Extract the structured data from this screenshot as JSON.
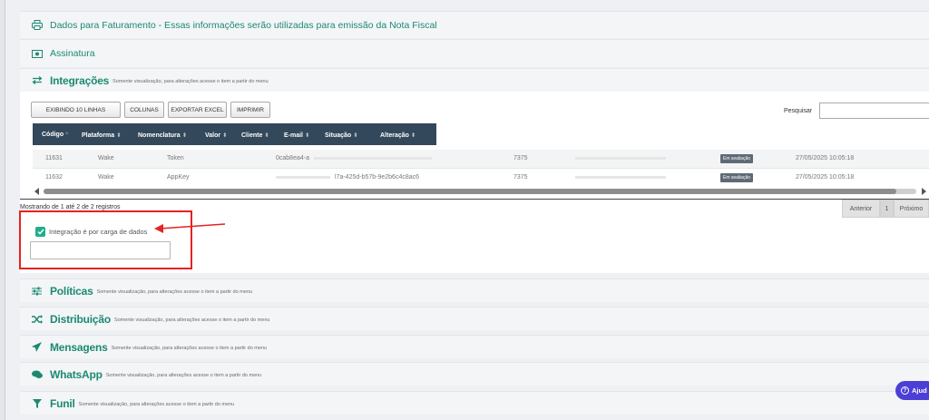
{
  "sections": {
    "faturamento": {
      "title": "Dados para Faturamento - Essas informações serão utilizadas para emissão da Nota Fiscal",
      "icon": "printer-icon"
    },
    "assinatura": {
      "title": "Assinatura",
      "icon": "money-bill-icon"
    },
    "integracoes": {
      "title": "Integrações",
      "subtitle": "Somente visualização, para alterações acesse o item a partir do menu",
      "icon": "exchange-icon"
    },
    "politicas": {
      "title": "Políticas",
      "subtitle": "Somente visualização, para alterações acesse o item a partir do menu",
      "icon": "sliders-icon"
    },
    "distribuicao": {
      "title": "Distribuição",
      "subtitle": "Somente visualização, para alterações acesse o item a partir do menu",
      "icon": "shuffle-icon"
    },
    "mensagens": {
      "title": "Mensagens",
      "subtitle": "Somente visualização, para alterações acesse o item a partir do menu",
      "icon": "send-icon"
    },
    "whatsapp": {
      "title": "WhatsApp",
      "subtitle": "Somente visualização, para alterações acesse o item a partir do menu",
      "icon": "chat-icon"
    },
    "funil": {
      "title": "Funil",
      "subtitle": "Somente visualização, para alterações acesse o item a partir do menu",
      "icon": "filter-icon"
    }
  },
  "toolbar": {
    "rows_label": "EXIBINDO 10 LINHAS",
    "columns_label": "COLUNAS",
    "export_label": "EXPORTAR EXCEL",
    "print_label": "IMPRIMIR",
    "search_label": "Pesquisar",
    "search_value": ""
  },
  "table": {
    "columns": [
      "Código",
      "Plataforma",
      "Nomenclatura",
      "Valor",
      "Cliente",
      "E-mail",
      "Situação",
      "Alteração"
    ],
    "rows": [
      {
        "codigo": "11631",
        "plataforma": "Wake",
        "nomenclatura": "Token",
        "valor": "0cab8ea4-a",
        "email": "7375",
        "situacao": "Em avaliação",
        "alteracao": "27/05/2025 10:05:18"
      },
      {
        "codigo": "11632",
        "plataforma": "Wake",
        "nomenclatura": "AppKey",
        "valor": "l7a-425d-b57b-9e2b6c4c8ac6",
        "email": "7375",
        "situacao": "Em avaliação",
        "alteracao": "27/05/2025 10:05:18"
      }
    ]
  },
  "footer": {
    "info": "Mostrando de 1 até 2 de 2 registros",
    "prev_label": "Anterior",
    "page": "1",
    "next_label": "Próximo"
  },
  "form": {
    "checkbox_label": "Integração é por carga de dados",
    "checkbox_checked": true,
    "input_value": ""
  },
  "help": {
    "label": "Ajud"
  },
  "colors": {
    "accent": "#1b8a73",
    "table_header": "#33485a",
    "highlight": "#e62222",
    "help": "#4c3fd6"
  }
}
